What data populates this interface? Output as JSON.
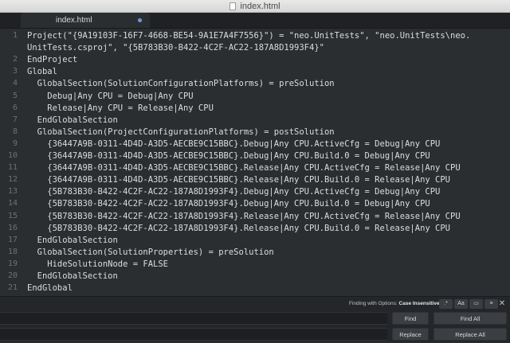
{
  "window": {
    "title": "index.html"
  },
  "tabs": [
    {
      "label": "index.html",
      "modified": true
    }
  ],
  "editor": {
    "line_numbers": [
      "1",
      "",
      "2",
      "3",
      "4",
      "5",
      "6",
      "7",
      "8",
      "9",
      "10",
      "11",
      "12",
      "13",
      "14",
      "15",
      "16",
      "17",
      "18",
      "19",
      "20",
      "21",
      "22"
    ],
    "lines": [
      "Project(\"{9A19103F-16F7-4668-BE54-9A1E7A4F7556}\") = \"neo.UnitTests\", \"neo.UnitTests\\neo.",
      "UnitTests.csproj\", \"{5B783B30-B422-4C2F-AC22-187A8D1993F4}\"",
      "EndProject",
      "Global",
      "  GlobalSection(SolutionConfigurationPlatforms) = preSolution",
      "    Debug|Any CPU = Debug|Any CPU",
      "    Release|Any CPU = Release|Any CPU",
      "  EndGlobalSection",
      "  GlobalSection(ProjectConfigurationPlatforms) = postSolution",
      "    {36447A9B-0311-4D4D-A3D5-AECBE9C15BBC}.Debug|Any CPU.ActiveCfg = Debug|Any CPU",
      "    {36447A9B-0311-4D4D-A3D5-AECBE9C15BBC}.Debug|Any CPU.Build.0 = Debug|Any CPU",
      "    {36447A9B-0311-4D4D-A3D5-AECBE9C15BBC}.Release|Any CPU.ActiveCfg = Release|Any CPU",
      "    {36447A9B-0311-4D4D-A3D5-AECBE9C15BBC}.Release|Any CPU.Build.0 = Release|Any CPU",
      "    {5B783B30-B422-4C2F-AC22-187A8D1993F4}.Debug|Any CPU.ActiveCfg = Debug|Any CPU",
      "    {5B783B30-B422-4C2F-AC22-187A8D1993F4}.Debug|Any CPU.Build.0 = Debug|Any CPU",
      "    {5B783B30-B422-4C2F-AC22-187A8D1993F4}.Release|Any CPU.ActiveCfg = Release|Any CPU",
      "    {5B783B30-B422-4C2F-AC22-187A8D1993F4}.Release|Any CPU.Build.0 = Release|Any CPU",
      "  EndGlobalSection",
      "  GlobalSection(SolutionProperties) = preSolution",
      "    HideSolutionNode = FALSE",
      "  EndGlobalSection",
      "EndGlobal",
      ""
    ]
  },
  "find_panel": {
    "status_prefix": "Finding with Options: ",
    "status_option": "Case Insensitive",
    "options": [
      {
        "icon": "regex-icon",
        "glyph": ".*"
      },
      {
        "icon": "case-sensitive-icon",
        "glyph": "Aa"
      },
      {
        "icon": "whole-word-icon",
        "glyph": "▭"
      },
      {
        "icon": "in-selection-icon",
        "glyph": "≡"
      }
    ],
    "find_value": "",
    "replace_value": "",
    "find_label": "Find",
    "find_all_label": "Find All",
    "replace_label": "Replace",
    "replace_all_label": "Replace All"
  }
}
